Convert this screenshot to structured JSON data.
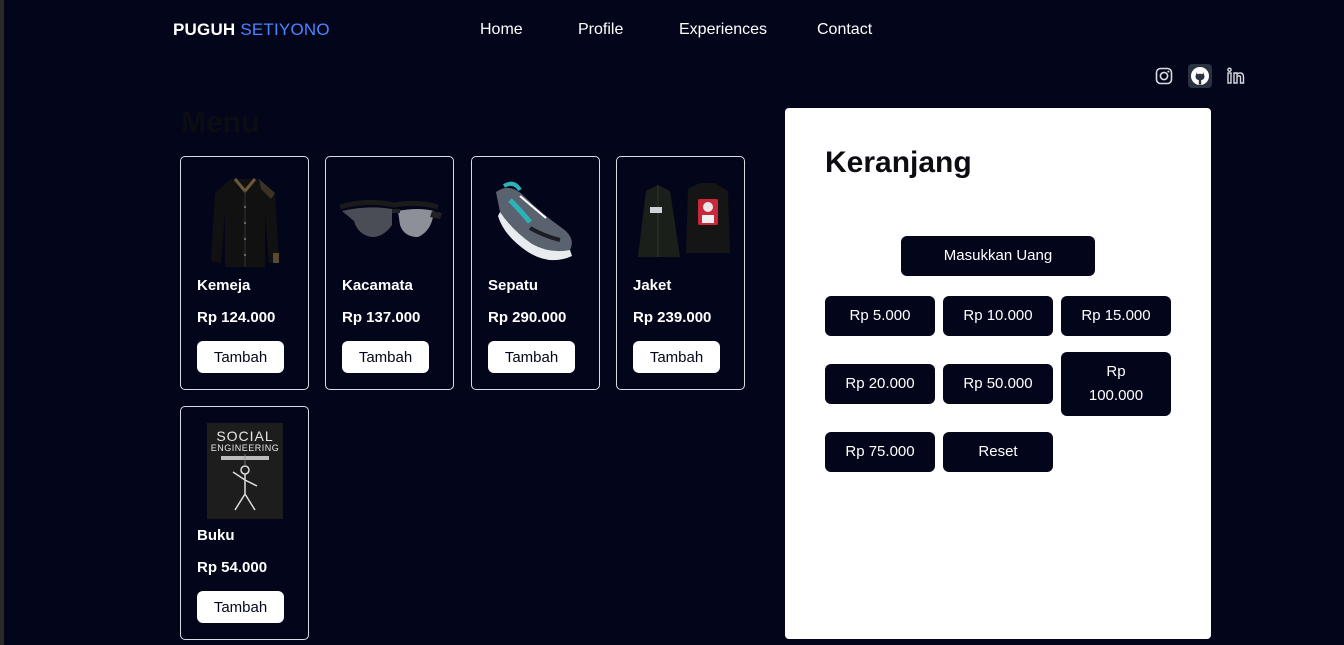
{
  "brand": {
    "first": "PUGUH",
    "last": "SETIYONO"
  },
  "nav": {
    "items": [
      "Home",
      "Profile",
      "Experiences",
      "Contact"
    ]
  },
  "socials": [
    "instagram-icon",
    "github-icon",
    "linkedin-icon"
  ],
  "menu": {
    "title": "Menu",
    "add_label": "Tambah",
    "products": [
      {
        "name": "Kemeja",
        "price": "Rp 124.000",
        "image": "shirt"
      },
      {
        "name": "Kacamata",
        "price": "Rp 137.000",
        "image": "sunglasses"
      },
      {
        "name": "Sepatu",
        "price": "Rp 290.000",
        "image": "sneakers"
      },
      {
        "name": "Jaket",
        "price": "Rp 239.000",
        "image": "jacket"
      },
      {
        "name": "Buku",
        "price": "Rp 54.000",
        "image": "book",
        "cover_text": [
          "SOCIAL",
          "ENGINEERING"
        ]
      }
    ]
  },
  "cart": {
    "title": "Keranjang",
    "insert_money_label": "Masukkan Uang",
    "amounts": [
      "Rp 5.000",
      "Rp 10.000",
      "Rp 15.000",
      "Rp 20.000",
      "Rp 50.000",
      "Rp 100.000",
      "Rp 75.000"
    ],
    "reset_label": "Reset"
  },
  "colors": {
    "background": "#03061a",
    "accent": "#4a86ff",
    "panel": "#ffffff"
  }
}
